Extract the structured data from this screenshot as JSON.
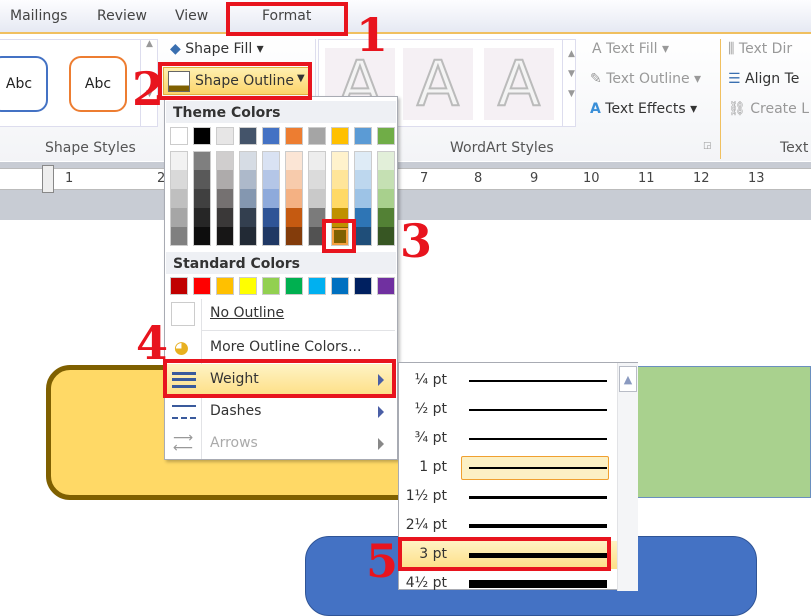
{
  "tabs": [
    "Mailings",
    "Review",
    "View",
    "Format"
  ],
  "ribbon": {
    "shape_styles": {
      "label": "Shape Styles",
      "samples": [
        "Abc",
        "Abc"
      ],
      "shape_fill": "Shape Fill",
      "shape_outline": "Shape Outline"
    },
    "wordart": {
      "label": "WordArt Styles",
      "samples": [
        "A",
        "A",
        "A"
      ],
      "text_fill": "Text Fill",
      "text_outline": "Text Outline",
      "text_effects": "Text Effects"
    },
    "text": {
      "label": "Text",
      "text_direction": "Text Dir",
      "align_text": "Align Te",
      "create_link": "Create L"
    }
  },
  "ruler": [
    "1",
    "2",
    "7",
    "8",
    "9",
    "10",
    "11",
    "12",
    "13"
  ],
  "menu": {
    "theme_header": "Theme Colors",
    "theme_base": [
      "#ffffff",
      "#000000",
      "#e7e6e6",
      "#44546a",
      "#4472c4",
      "#ed7d31",
      "#a5a5a5",
      "#ffc000",
      "#5b9bd5",
      "#70ad47"
    ],
    "theme_shades": [
      [
        "#f2f2f2",
        "#d9d9d9",
        "#bfbfbf",
        "#a6a6a6",
        "#808080"
      ],
      [
        "#7f7f7f",
        "#595959",
        "#404040",
        "#262626",
        "#0d0d0d"
      ],
      [
        "#d0cece",
        "#aeabab",
        "#757171",
        "#3a3838",
        "#171616"
      ],
      [
        "#d6dce4",
        "#adb9ca",
        "#8497b0",
        "#333f4f",
        "#222a35"
      ],
      [
        "#d9e2f3",
        "#b4c6e7",
        "#8eaadb",
        "#2f5496",
        "#1f3864"
      ],
      [
        "#fbe5d5",
        "#f7cbac",
        "#f4b183",
        "#c55a11",
        "#833c0b"
      ],
      [
        "#ededed",
        "#dbdbdb",
        "#c9c9c9",
        "#7b7b7b",
        "#525252"
      ],
      [
        "#fff2cc",
        "#ffe599",
        "#ffd966",
        "#bf9000",
        "#7f6000"
      ],
      [
        "#deebf6",
        "#bdd7ee",
        "#9dc3e6",
        "#2e75b5",
        "#1f4e79"
      ],
      [
        "#e2efd9",
        "#c5e0b3",
        "#a8d08d",
        "#538135",
        "#375623"
      ]
    ],
    "selected_color": "#7f6000",
    "standard_header": "Standard Colors",
    "standard": [
      "#c00000",
      "#ff0000",
      "#ffc000",
      "#ffff00",
      "#92d050",
      "#00b050",
      "#00b0f0",
      "#0070c0",
      "#002060",
      "#7030a0"
    ],
    "no_outline": "No Outline",
    "more_colors": "More Outline Colors...",
    "weight": "Weight",
    "dashes": "Dashes",
    "arrows": "Arrows"
  },
  "weights": [
    {
      "label": "¼ pt",
      "pt": 0.25
    },
    {
      "label": "½ pt",
      "pt": 0.5
    },
    {
      "label": "¾ pt",
      "pt": 0.75
    },
    {
      "label": "1 pt",
      "pt": 1,
      "current": true
    },
    {
      "label": "1½ pt",
      "pt": 1.5
    },
    {
      "label": "2¼ pt",
      "pt": 2.25
    },
    {
      "label": "3 pt",
      "pt": 3,
      "hovered": true
    },
    {
      "label": "4½ pt",
      "pt": 4.5
    }
  ],
  "annotations": [
    "1",
    "2",
    "3",
    "4",
    "5"
  ],
  "colors": {
    "annotation": "#e8141e",
    "highlight": "#fde58a",
    "yellow_shape": "#ffd966",
    "yellow_border": "#7f6000",
    "green_shape": "#a9d18e",
    "blue_shape": "#4472c4"
  }
}
